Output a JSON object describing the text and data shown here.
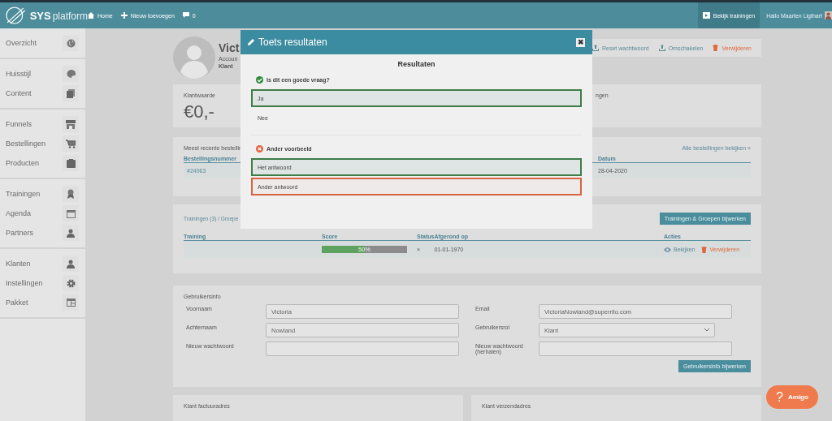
{
  "topbar": {
    "logo": "SYS",
    "logo_suffix": "platform",
    "nav": [
      {
        "label": "Home"
      },
      {
        "label": "Nieuw toevoegen"
      },
      {
        "label": "0"
      }
    ],
    "watch_button": "Bekijk trainingen",
    "greeting": "Hallo Maarten Ligthart"
  },
  "sidebar": {
    "groups": [
      [
        {
          "label": "Overzicht"
        }
      ],
      [
        {
          "label": "Huisstijl"
        },
        {
          "label": "Content"
        }
      ],
      [
        {
          "label": "Funnels"
        },
        {
          "label": "Bestellingen"
        },
        {
          "label": "Producten"
        }
      ],
      [
        {
          "label": "Trainingen"
        },
        {
          "label": "Agenda"
        },
        {
          "label": "Partners"
        }
      ],
      [
        {
          "label": "Klanten"
        },
        {
          "label": "Instellingen"
        },
        {
          "label": "Pakket"
        }
      ]
    ]
  },
  "profile": {
    "name": "Vict",
    "account": "Accoun",
    "role": "Klant",
    "actions": [
      {
        "label": "Reset wachtwoord",
        "kind": "normal"
      },
      {
        "label": "Omschakelen",
        "kind": "normal"
      },
      {
        "label": "Verwijderen",
        "kind": "danger"
      }
    ]
  },
  "stats": [
    {
      "label": "Klantwaarde",
      "value": "€0,-"
    },
    {
      "label": "ngen"
    }
  ],
  "orders": {
    "title": "Meest recente bestellin",
    "link": "Alle bestellingen bekijken »",
    "columns": [
      "Bestellingsnummer",
      "Datum"
    ],
    "rows": [
      [
        "#24963",
        "28-04-2020"
      ]
    ]
  },
  "trainings": {
    "title": "Trainingen (3) / Groepe",
    "button": "Trainingen & Groepen bijwerken",
    "columns": [
      "Training",
      "Score",
      "Status",
      "Afgerond op",
      "Acties"
    ],
    "rows": [
      {
        "score": {
          "level": 0.5,
          "label": "50%"
        },
        "status": "×",
        "completed": "01-01-1970",
        "actions": [
          {
            "label": "Bekijken",
            "kind": "view"
          },
          {
            "label": "Verwijderen",
            "kind": "delete"
          }
        ]
      }
    ]
  },
  "user_info": {
    "title": "Gebruikersinfo",
    "fields": [
      {
        "label": "Voornaam",
        "value": "Victoria",
        "kind": "text"
      },
      {
        "label": "Email",
        "value": "VictoriaNowland@superrito.com",
        "kind": "text"
      },
      {
        "label": "Achternaam",
        "value": "Nowland",
        "kind": "text"
      },
      {
        "label": "Gebruikersrol",
        "value": "Klant",
        "kind": "select"
      },
      {
        "label": "Nieuw wachtwoord",
        "kind": "text"
      },
      {
        "label": "Nieuw wachtwoord (herhalen)",
        "kind": "text"
      }
    ],
    "button": "Gebruikersinfo bijwerken"
  },
  "addresses": [
    {
      "title": "Klant factuuradres"
    },
    {
      "title": "Klant verzendadres"
    }
  ],
  "modal": {
    "title": "Toets resultaten",
    "close": "✖",
    "heading": "Resultaten",
    "questions": [
      {
        "text": "Is dit een goede vraag?",
        "correct": true,
        "options": [
          {
            "label": "Ja",
            "kind": "correct"
          },
          {
            "label": "Nee",
            "kind": "plain"
          }
        ]
      },
      {
        "text": "Ander voorbeeld",
        "correct": false,
        "options": [
          {
            "label": "Het antwoord",
            "kind": "correct"
          },
          {
            "label": "Ander antwoord",
            "kind": "wrong"
          }
        ]
      }
    ]
  },
  "help_button": {
    "icon": "?",
    "label": "Amigo"
  }
}
